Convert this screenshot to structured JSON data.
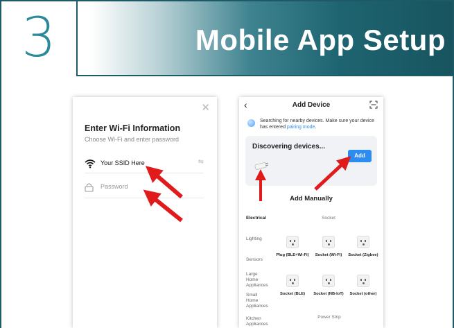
{
  "header": {
    "step": "3",
    "title": "Mobile App Setup"
  },
  "wifi_screen": {
    "close_icon": "close-icon",
    "title": "Enter Wi-Fi Information",
    "subtitle": "Choose Wi-Fi and enter password",
    "ssid": "Your SSID Here",
    "password_placeholder": "Password"
  },
  "add_device_screen": {
    "title": "Add Device",
    "search_text": "Searching for nearby devices. Make sure your device has entered ",
    "search_link": "pairing mode",
    "search_end": ".",
    "discovering": "Discovering devices...",
    "add_button": "Add",
    "add_manually": "Add Manually",
    "categories": [
      "Electrical",
      "Lighting",
      "Sensors",
      "Large Home Appliances",
      "Small Home Appliances",
      "Kitchen Appliances"
    ],
    "column_header": "Socket",
    "devices": [
      {
        "label": "Plug (BLE+Wi-Fi)"
      },
      {
        "label": "Socket (Wi-Fi)"
      },
      {
        "label": "Socket (Zigbee)"
      },
      {
        "label": "Socket (BLE)"
      },
      {
        "label": "Socket (NB-IoT)"
      },
      {
        "label": "Socket (other)"
      }
    ],
    "power_strip": "Power Strip"
  },
  "colors": {
    "accent": "#1e5a66",
    "arrow": "#e01b1b",
    "button": "#2d8cf0"
  }
}
